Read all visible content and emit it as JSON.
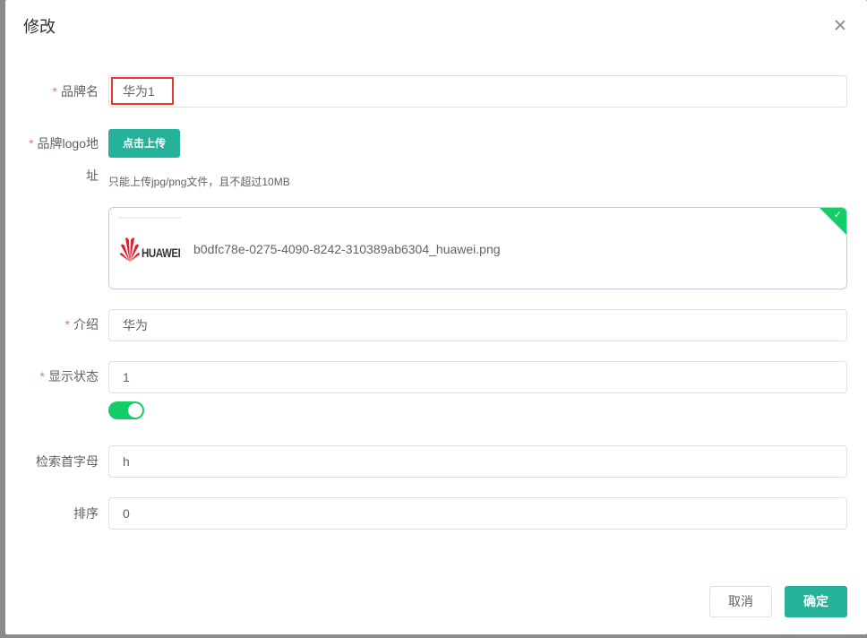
{
  "dialog": {
    "title": "修改",
    "close_icon": "close-icon"
  },
  "form": {
    "brand_name": {
      "label": "品牌名",
      "required": "*",
      "value": "华为1"
    },
    "logo": {
      "label_line1": "品牌logo地",
      "label_line2": "址",
      "required": "*",
      "upload_label": "点击上传",
      "tip": "只能上传jpg/png文件，且不超过10MB",
      "thumb_text": "HUAWEI",
      "file_name": "b0dfc78e-0275-4090-8242-310389ab6304_huawei.png",
      "status_icon": "check-icon",
      "status_color": "#13ce66"
    },
    "intro": {
      "label": "介绍",
      "required": "*",
      "value": "华为"
    },
    "show_status": {
      "label": "显示状态",
      "required": "*",
      "value": "1",
      "switch_on": true,
      "switch_color": "#13ce66"
    },
    "first_letter": {
      "label": "检索首字母",
      "value": "h"
    },
    "sort": {
      "label": "排序",
      "value": "0"
    }
  },
  "footer": {
    "cancel_label": "取消",
    "confirm_label": "确定"
  },
  "colors": {
    "accent": "#26b29a",
    "required": "#f56c6c",
    "highlight_box": "#e53935"
  }
}
